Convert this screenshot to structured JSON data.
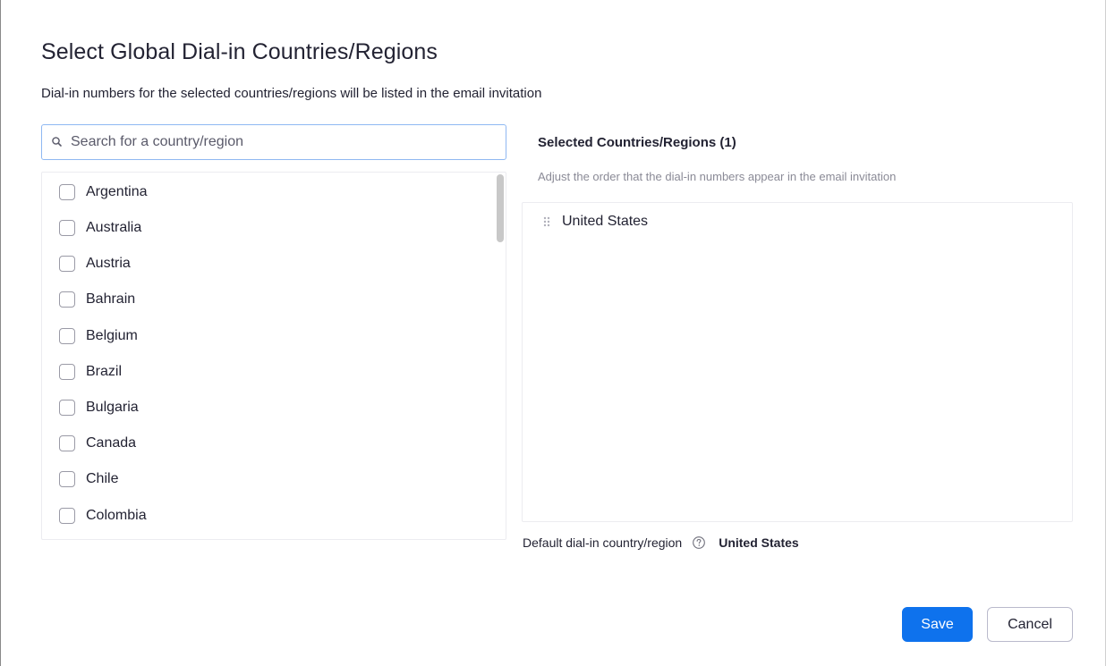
{
  "dialog": {
    "title": "Select Global Dial-in Countries/Regions",
    "subtitle": "Dial-in numbers for the selected countries/regions will be listed in the email invitation"
  },
  "search": {
    "placeholder": "Search for a country/region",
    "value": "",
    "icon": "search-icon"
  },
  "countries": [
    {
      "label": "Argentina",
      "checked": false
    },
    {
      "label": "Australia",
      "checked": false
    },
    {
      "label": "Austria",
      "checked": false
    },
    {
      "label": "Bahrain",
      "checked": false
    },
    {
      "label": "Belgium",
      "checked": false
    },
    {
      "label": "Brazil",
      "checked": false
    },
    {
      "label": "Bulgaria",
      "checked": false
    },
    {
      "label": "Canada",
      "checked": false
    },
    {
      "label": "Chile",
      "checked": false
    },
    {
      "label": "Colombia",
      "checked": false
    }
  ],
  "selected": {
    "heading": "Selected Countries/Regions (1)",
    "hint": "Adjust the order that the dial-in numbers appear in the email invitation",
    "items": [
      {
        "label": "United States",
        "icon": "drag-handle-icon"
      }
    ]
  },
  "default_region": {
    "label": "Default dial-in country/region",
    "help_icon": "help-circle-icon",
    "value": "United States"
  },
  "buttons": {
    "save": "Save",
    "cancel": "Cancel"
  },
  "colors": {
    "primary": "#0e72ed",
    "text": "#232333",
    "muted": "#8a8a96",
    "focus_border": "#8fb8f2"
  }
}
